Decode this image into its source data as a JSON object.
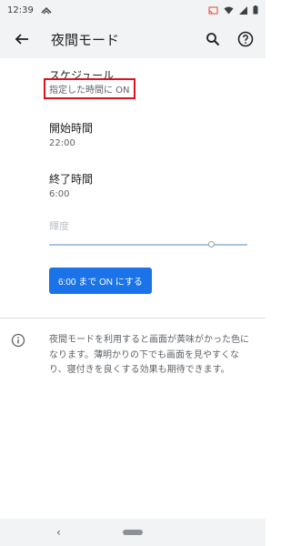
{
  "status_bar": {
    "time": "12:39"
  },
  "app_bar": {
    "title": "夜間モード"
  },
  "schedule": {
    "title": "スケジュール",
    "value": "指定した時間に ON"
  },
  "start_time": {
    "title": "開始時間",
    "value": "22:00"
  },
  "end_time": {
    "title": "終了時間",
    "value": "6:00"
  },
  "brightness": {
    "label": "輝度",
    "level": 0.83
  },
  "action_button": {
    "label": "6:00 まで ON にする"
  },
  "info": {
    "text": "夜間モードを利用すると画面が黄味がかった色になります。薄明かりの下でも画面を見やすくなり、寝付きを良くする効果も期待できます。"
  },
  "colors": {
    "accent": "#1a73e8",
    "highlight_border": "#e01020"
  }
}
